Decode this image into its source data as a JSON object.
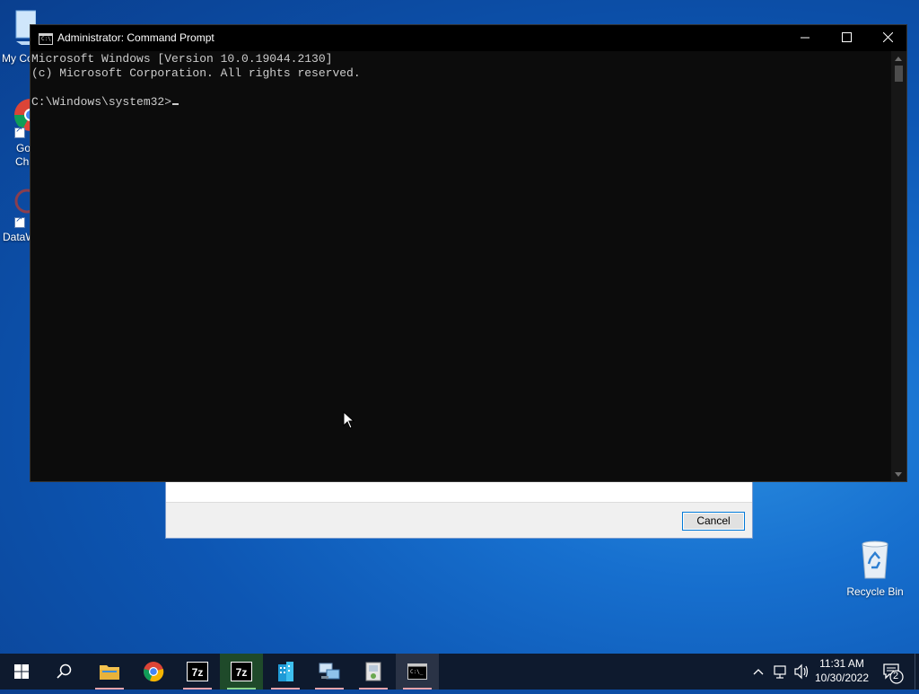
{
  "desktop": {
    "icons": [
      {
        "label": "My Co"
      },
      {
        "label_line1": "Go",
        "label_line2": "Ch"
      },
      {
        "label": "DataW"
      }
    ],
    "recycle_bin": {
      "label": "Recycle Bin"
    }
  },
  "background_dialog": {
    "cancel_label": "Cancel"
  },
  "cmd_window": {
    "title": "Administrator: Command Prompt",
    "lines": [
      "Microsoft Windows [Version 10.0.19044.2130]",
      "(c) Microsoft Corporation. All rights reserved.",
      "",
      "C:\\Windows\\system32>"
    ]
  },
  "taskbar": {
    "apps": [
      {
        "name": "file-explorer-icon"
      },
      {
        "name": "chrome-icon"
      },
      {
        "name": "7zip-icon",
        "text": "7z"
      },
      {
        "name": "7zip-filemanager-icon",
        "text": "7z"
      },
      {
        "name": "building-app-icon"
      },
      {
        "name": "network-computer-icon"
      },
      {
        "name": "installer-icon"
      },
      {
        "name": "command-prompt-icon"
      }
    ],
    "clock": {
      "time": "11:31 AM",
      "date": "10/30/2022"
    },
    "notifications_count": "2"
  },
  "colors": {
    "console_bg": "#0c0c0c",
    "console_text": "#cccccc",
    "taskbar_bg": "#0e1a2e",
    "accent": "#0078d7"
  }
}
